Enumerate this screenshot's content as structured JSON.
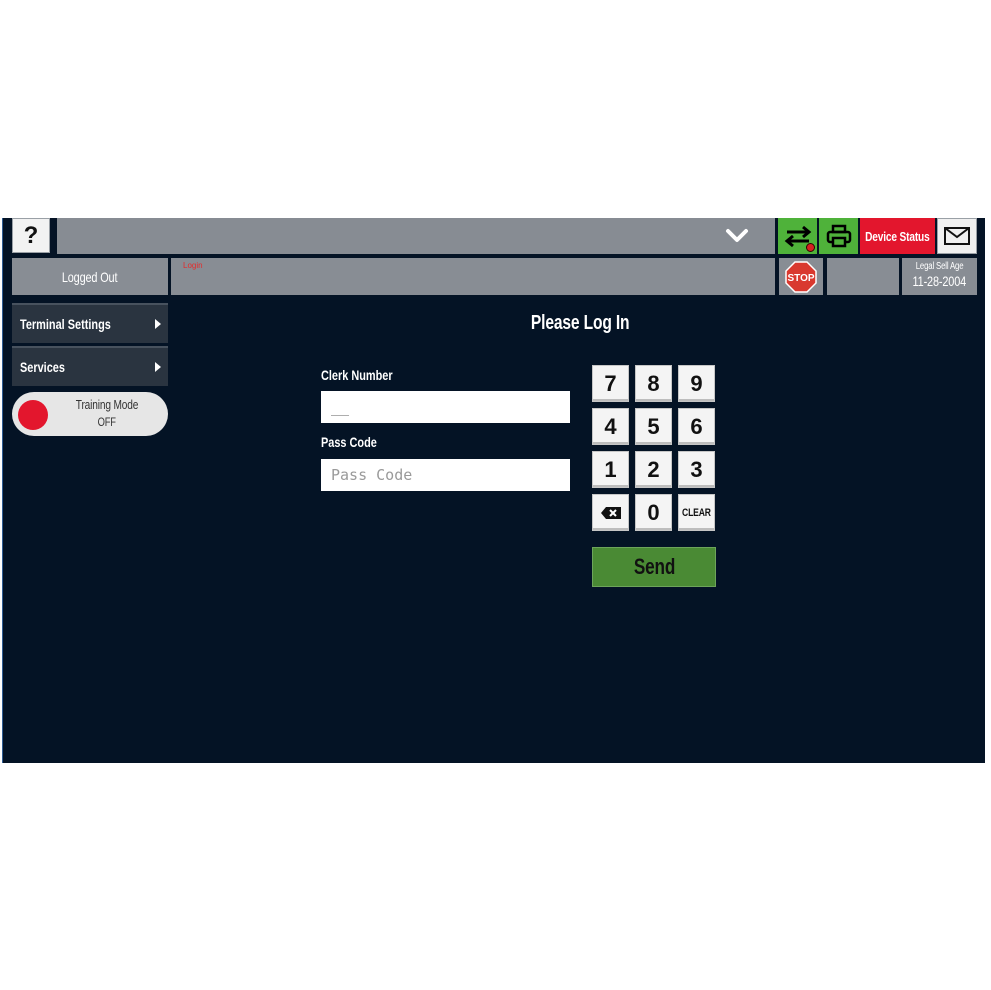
{
  "header": {
    "help_label": "?",
    "device_status_label": "Device Status",
    "icons": {
      "dropdown": "chevron-down-icon",
      "transfer": "transfer-arrows-icon",
      "print": "printer-icon",
      "mail": "envelope-icon",
      "stop": "stop-sign-icon"
    }
  },
  "status_row": {
    "logged_out_label": "Logged Out",
    "login_label": "Login",
    "stop_label": "STOP",
    "legal_sell_age_label": "Legal Sell Age",
    "legal_sell_age_date": "11-28-2004"
  },
  "sidebar": {
    "items": [
      {
        "label": "Terminal Settings"
      },
      {
        "label": "Services"
      }
    ],
    "training_mode": {
      "label": "Training Mode",
      "value": "OFF"
    }
  },
  "login": {
    "heading": "Please Log In",
    "clerk_number_label": "Clerk Number",
    "clerk_number_value": "__",
    "pass_code_label": "Pass Code",
    "pass_code_placeholder": "Pass Code",
    "send_label": "Send"
  },
  "keypad": {
    "keys": [
      "7",
      "8",
      "9",
      "4",
      "5",
      "6",
      "1",
      "2",
      "3",
      "backspace",
      "0",
      "CLEAR"
    ],
    "labels": {
      "k7": "7",
      "k8": "8",
      "k9": "9",
      "k4": "4",
      "k5": "5",
      "k6": "6",
      "k1": "1",
      "k2": "2",
      "k3": "3",
      "k0": "0",
      "clear": "CLEAR"
    }
  },
  "colors": {
    "app_background": "#041325",
    "bar_gray": "#878c93",
    "green": "#4fb23a",
    "red": "#e3162d",
    "send_green": "#4a8a34"
  }
}
